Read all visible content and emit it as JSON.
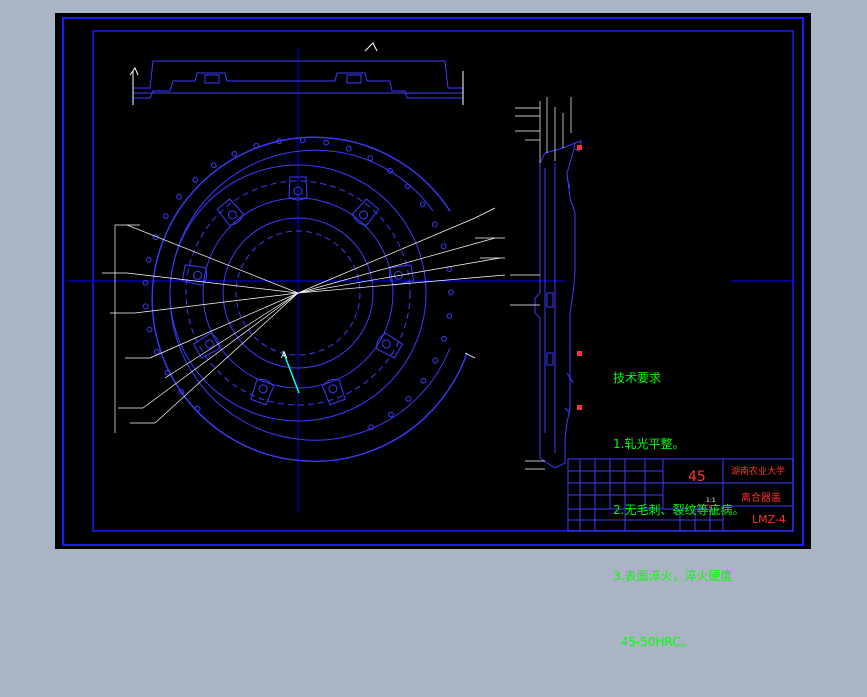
{
  "drawing": {
    "material": "45",
    "title_top": "湖南农业大学",
    "part_name": "离合器盖",
    "drawing_code": "LMZ-4",
    "scale": "1:1",
    "section_label": "A"
  },
  "tech_requirements": {
    "heading": "技术要求",
    "items": [
      "1.轧光平整。",
      "2.无毛刺、裂纹等疵病。",
      "3.表面淬火，淬火硬度",
      "  45-50HRC。"
    ]
  },
  "colors": {
    "background": "#000000",
    "frame": "#0000ff",
    "geometry": "#3b3bff",
    "dimensions": "#ffffff",
    "annotation_red": "#ff3333",
    "annotation_green": "#00ff00",
    "center_line": "#00ffff"
  }
}
